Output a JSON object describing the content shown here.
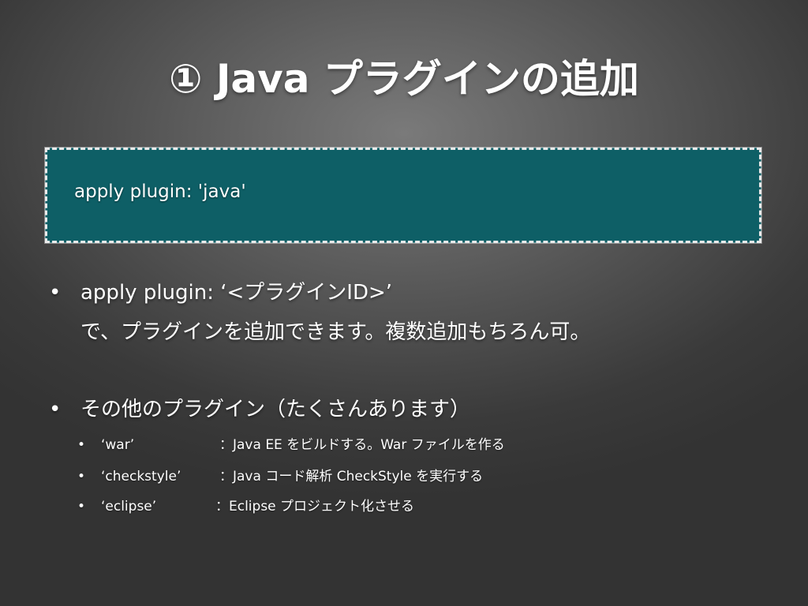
{
  "slide": {
    "title": "① Java プラグインの追加",
    "code": "apply plugin: 'java'",
    "bullets": [
      {
        "line1": "apply plugin: ‘<プラグインID>’",
        "line2": "で、プラグインを追加できます。複数追加もちろん可。"
      },
      {
        "line1": "その他のプラグイン（たくさんあります）"
      }
    ],
    "bullet_marker": "•",
    "sub_items": [
      {
        "name": "‘war’",
        "desc": "：Java EE をビルドする。War ファイルを作る"
      },
      {
        "name": "‘checkstyle’",
        "desc": "：Java コード解析 CheckStyle を実行する"
      },
      {
        "name": "‘eclipse’",
        "desc": "：Eclipse プロジェクト化させる"
      }
    ],
    "colors": {
      "code_box_bg": "#0e5f66",
      "code_box_border": "#e8e8e8",
      "text": "#ffffff"
    }
  }
}
